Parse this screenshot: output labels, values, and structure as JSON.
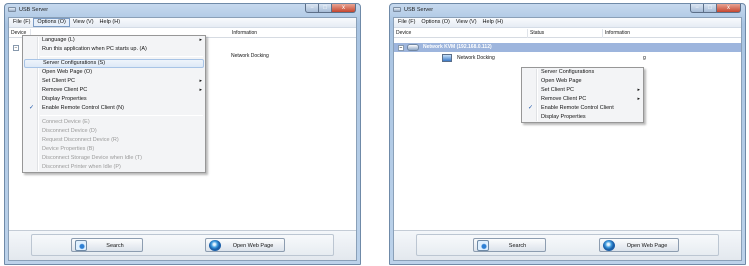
{
  "app": {
    "title": "USB Server"
  },
  "menubar": {
    "file": "File (F)",
    "options": "Options (O)",
    "view": "View (V)",
    "help": "Help (H)"
  },
  "columns": {
    "device": "Device",
    "status": "Status",
    "information": "Information"
  },
  "left": {
    "columns": {
      "device": "Device",
      "information": "Information"
    },
    "row_info": "Network Docking",
    "options_menu": [
      {
        "label": "Language (L)",
        "submenu": true
      },
      {
        "label": "Run this application when PC starts up. (A)"
      },
      {
        "separator": true
      },
      {
        "label": "Server Configurations (S)",
        "highlighted": true
      },
      {
        "label": "Open Web Page (O)"
      },
      {
        "label": "Set Client PC",
        "submenu": true
      },
      {
        "label": "Remove Client PC",
        "submenu": true
      },
      {
        "label": "Display Properties"
      },
      {
        "label": "Enable Remote Control Client (N)",
        "checked": true
      },
      {
        "separator": true
      },
      {
        "label": "Connect Device (E)",
        "disabled": true
      },
      {
        "label": "Disconnect Device (D)",
        "disabled": true
      },
      {
        "label": "Request Disconnect Device (R)",
        "disabled": true
      },
      {
        "label": "Device Properties (B)",
        "disabled": true
      },
      {
        "label": "Disconnect Storage Device when Idle (T)",
        "disabled": true
      },
      {
        "label": "Disconnect Printer when Idle (P)",
        "disabled": true
      }
    ]
  },
  "right": {
    "kvm_row": "Network KVM  (192.168.0.112)",
    "device_name": "Network Docking",
    "info_fragment": "g",
    "context_menu": [
      {
        "label": "Server Configurations"
      },
      {
        "label": "Open Web Page"
      },
      {
        "label": "Set Client PC",
        "submenu": true
      },
      {
        "label": "Remove Client PC",
        "submenu": true
      },
      {
        "label": "Enable Remote Control Client",
        "checked": true
      },
      {
        "label": "Display Properties"
      }
    ]
  },
  "buttons": {
    "search": "Search",
    "open_web_page": "Open Web Page"
  },
  "icons": {
    "minimize": "−",
    "maximize": "□",
    "close": "x",
    "check": "✓",
    "submenu": "▸",
    "collapse": "−"
  }
}
